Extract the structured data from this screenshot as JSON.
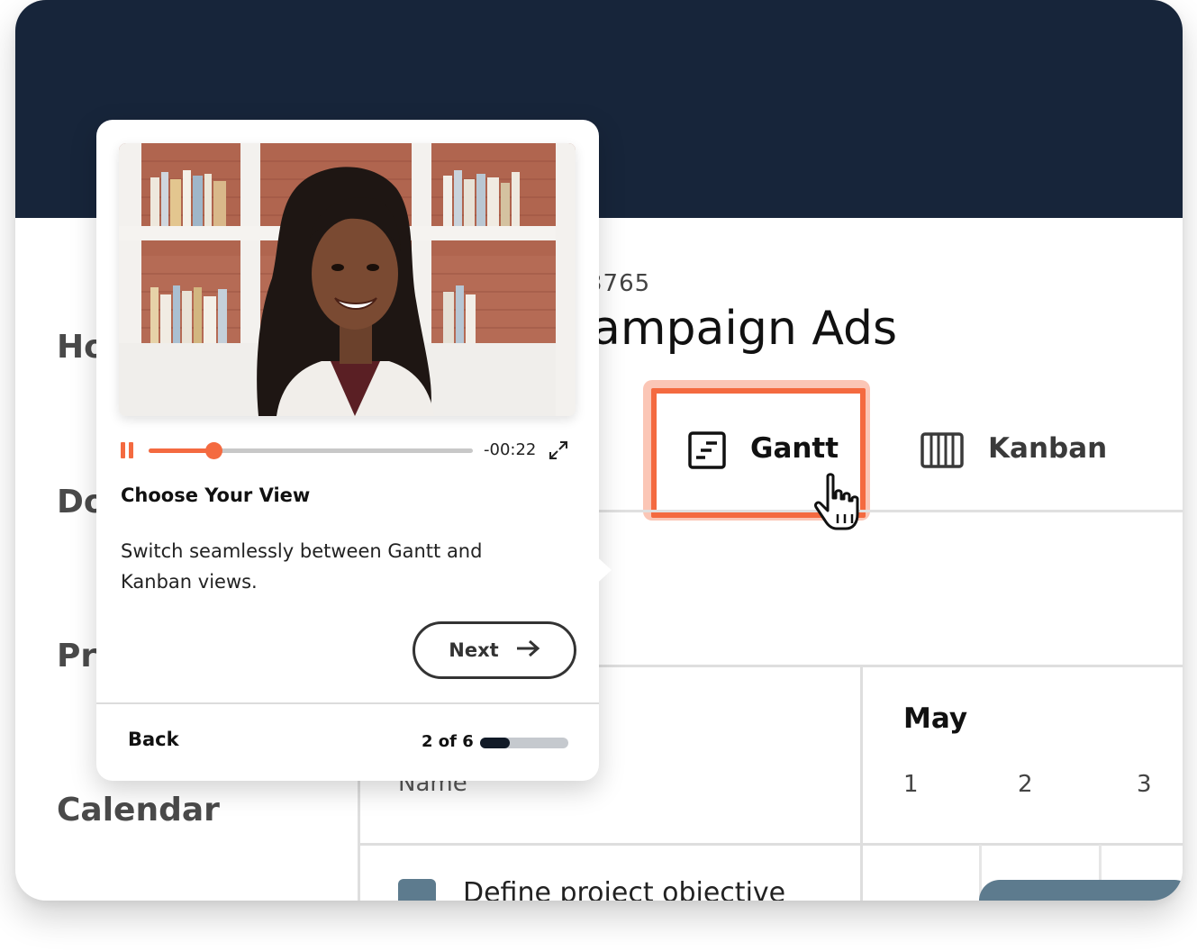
{
  "sidebar": {
    "items": [
      {
        "label": "Home"
      },
      {
        "label": "Docs"
      },
      {
        "label": "Projects"
      },
      {
        "label": "Calendar"
      }
    ]
  },
  "project": {
    "id_fragment": "3765",
    "title_fragment": "ampaign Ads"
  },
  "views": {
    "gantt_label": "Gantt",
    "kanban_label": "Kanban",
    "gantt_icon": "gantt-icon",
    "kanban_icon": "kanban-icon"
  },
  "grid": {
    "name_header": "Name",
    "month": "May",
    "days": [
      "1",
      "2",
      "3"
    ],
    "tasks": [
      {
        "name": "Define project objective"
      }
    ]
  },
  "tour": {
    "time_remaining": "-00:22",
    "playback_progress": 0.2,
    "title": "Choose Your View",
    "body": "Switch seamlessly between Gantt and Kanban views.",
    "next_label": "Next",
    "back_label": "Back",
    "step_label": "2 of 6",
    "step_current": 2,
    "step_total": 6
  },
  "colors": {
    "accent": "#f46a40",
    "header_dark": "#17253a",
    "task_color": "#5d7b8e"
  }
}
